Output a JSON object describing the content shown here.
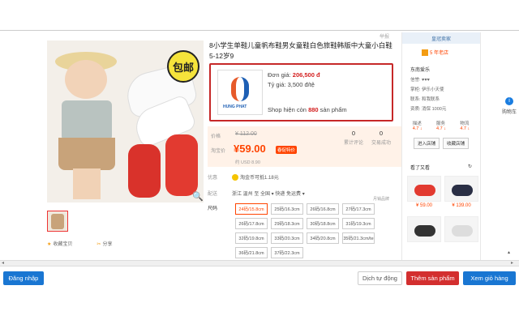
{
  "product": {
    "title": "8小学生单鞋儿童帆布鞋男女童鞋白色旅鞋韩版中大童小白鞋5-12岁9",
    "bao_mark": "举报",
    "badge": "包邮",
    "zoom": "🔍",
    "collect_label": "收藏宝贝",
    "share_label": "分享"
  },
  "seller": {
    "price_label": "Đơn giá:",
    "price_value": "206,500 đ",
    "rate_label": "Tỷ giá: 3,500 đ/tệ",
    "shop_text": "Shop hiện còn",
    "shop_count": "880",
    "shop_unit": "sản phẩm",
    "logo_text": "HUNG PHAT"
  },
  "price": {
    "old_label": "价格",
    "old_value": "¥ 112.00",
    "new_label": "淘宝价",
    "new_value": "¥59.00",
    "promo_badge": "春促特价",
    "usd": "约 USD 8.90",
    "stat1_num": "0",
    "stat1_label": "累计评论",
    "stat2_num": "0",
    "stat2_label": "交易成功"
  },
  "promo": {
    "label": "优惠",
    "value": "淘金币可抵1.18元"
  },
  "shipping": {
    "label": "配送",
    "value": "浙江 温州 至  全国 ▾  快递 免运费 ▾",
    "extra": "月销品牌"
  },
  "sizes": {
    "label": "尺码",
    "items": [
      "24码/15.8cm",
      "25码/16.3cm",
      "26码/16.8cm",
      "27码/17.3cm",
      "26码/17.8cm",
      "29码/18.3cm",
      "30码/18.8cm",
      "31码/19.3cm",
      "32码/19.8cm",
      "33码/20.3cm",
      "34码/20.8cm",
      "35码/21.3cm/te",
      "36码/21.8cm",
      "37码/22.3cm"
    ]
  },
  "right_col": {
    "head": "皇冠卖家",
    "shop_years": "5 年老店",
    "shop_name": "东南爱乐",
    "row1": "信誉: ♥♥♥",
    "row2": "掌柜: 伊乐小天使",
    "row3": "联系: 和我联系",
    "row4": "资质: 消保 1000元",
    "s1": "描述",
    "s1v": "4.7 ↓",
    "s2": "服务",
    "s2v": "4.7 ↓",
    "s3": "物流",
    "s3v": "4.7 ↓",
    "btn_enter": "进入店铺",
    "btn_fav": "收藏店铺",
    "watch_label": "看了又看",
    "refresh": "↻",
    "p1": "¥ 59.00",
    "p2": "¥ 139.00"
  },
  "sidebar": {
    "icon": "i",
    "text": "购物车"
  },
  "bottom": {
    "login": "Đăng nhập",
    "translate": "Dịch tự động",
    "add": "Thêm sản phẩm",
    "cart": "Xem giỏ hàng"
  },
  "colors": {
    "accent_red": "#d32f2f",
    "accent_blue": "#1976d2",
    "price_orange": "#ff4400"
  }
}
